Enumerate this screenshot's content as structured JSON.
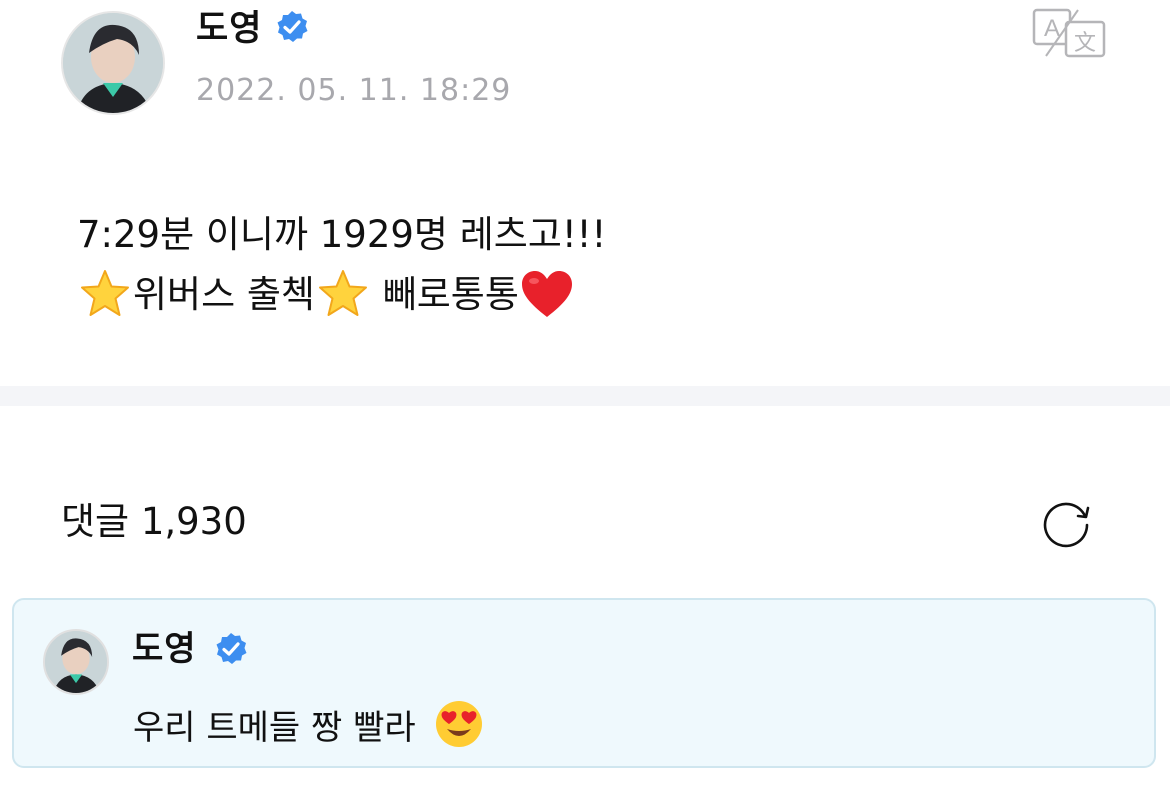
{
  "post": {
    "author": "도영",
    "timestamp": "2022. 05. 11. 18:29",
    "line1": "7:29분 이니까 1929명 레츠고!!!",
    "line2_part1": "위버스 출첵",
    "line2_part2": " 빼로통통",
    "emojis": [
      "star-emoji",
      "star-emoji",
      "red-heart-emoji"
    ]
  },
  "comments": {
    "title": "댓글 1,930"
  },
  "highlighted_comment": {
    "author": "도영",
    "text": "우리 트메들 짱 빨라",
    "emoji": "heart-eyes-emoji"
  },
  "icons": {
    "verified": "verified-badge-icon",
    "translate": "translate-icon",
    "refresh": "refresh-icon"
  },
  "colors": {
    "verified_blue": "#3d8ef0",
    "timestamp_gray": "#a8a8ad",
    "comment_bg": "#eff9fd",
    "comment_border": "#cfe6ef",
    "divider": "#f4f5f8"
  }
}
